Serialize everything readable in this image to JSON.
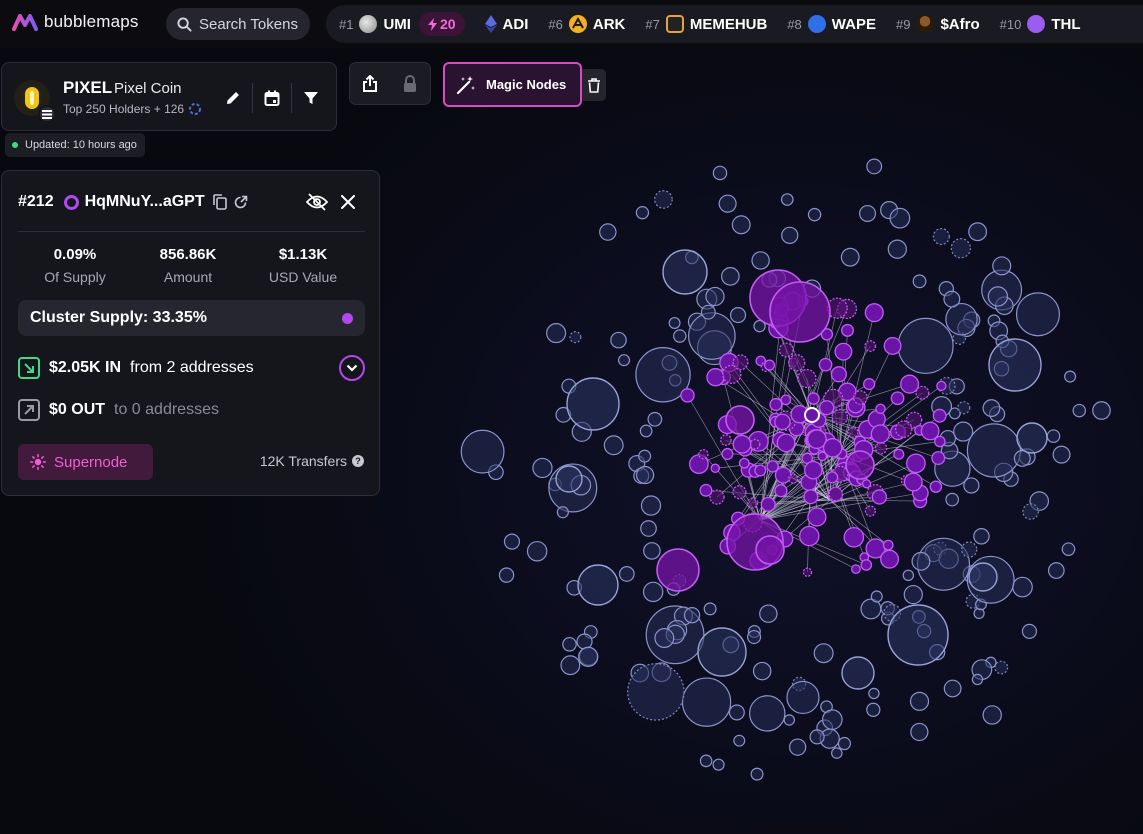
{
  "brand": {
    "name": "bubblemaps"
  },
  "search": {
    "label": "Search Tokens"
  },
  "ticker": [
    {
      "rank": "#1",
      "name": "UMI",
      "icon": "umi-token-icon",
      "boost": "20"
    },
    {
      "rank": "",
      "name": "ADI",
      "icon": "adi-token-icon"
    },
    {
      "rank": "#6",
      "name": "ARK",
      "icon": "ark-token-icon"
    },
    {
      "rank": "#7",
      "name": "MEMEHUB",
      "icon": "memehub-token-icon"
    },
    {
      "rank": "#8",
      "name": "WAPE",
      "icon": "wape-token-icon"
    },
    {
      "rank": "#9",
      "name": "$Afro",
      "icon": "afro-token-icon"
    },
    {
      "rank": "#10",
      "name": "THL",
      "icon": "thl-token-icon"
    }
  ],
  "token": {
    "symbol": "PIXEL",
    "name": "Pixel Coin",
    "holders_text": "Top 250 Holders + 126",
    "updated": "Updated: 10 hours ago"
  },
  "toolbar": {
    "magic_label": "Magic Nodes"
  },
  "wallet": {
    "rank": "#212",
    "address": "HqMNuY...aGPT",
    "stats": [
      {
        "value": "0.09%",
        "label": "Of Supply"
      },
      {
        "value": "856.86K",
        "label": "Amount"
      },
      {
        "value": "$1.13K",
        "label": "USD Value"
      }
    ],
    "cluster_supply": "Cluster Supply: 33.35%",
    "inflow": {
      "amount": "$2.05K IN",
      "detail": "from 2 addresses"
    },
    "outflow": {
      "amount": "$0 OUT",
      "detail": "to 0 addresses"
    },
    "supernode_label": "Supernode",
    "transfers": "12K Transfers"
  },
  "colors": {
    "accent_purple": "#b347f0",
    "magenta": "#d84bc4",
    "node_blue": "#8b93c9",
    "positive_green": "#3ddc84"
  }
}
